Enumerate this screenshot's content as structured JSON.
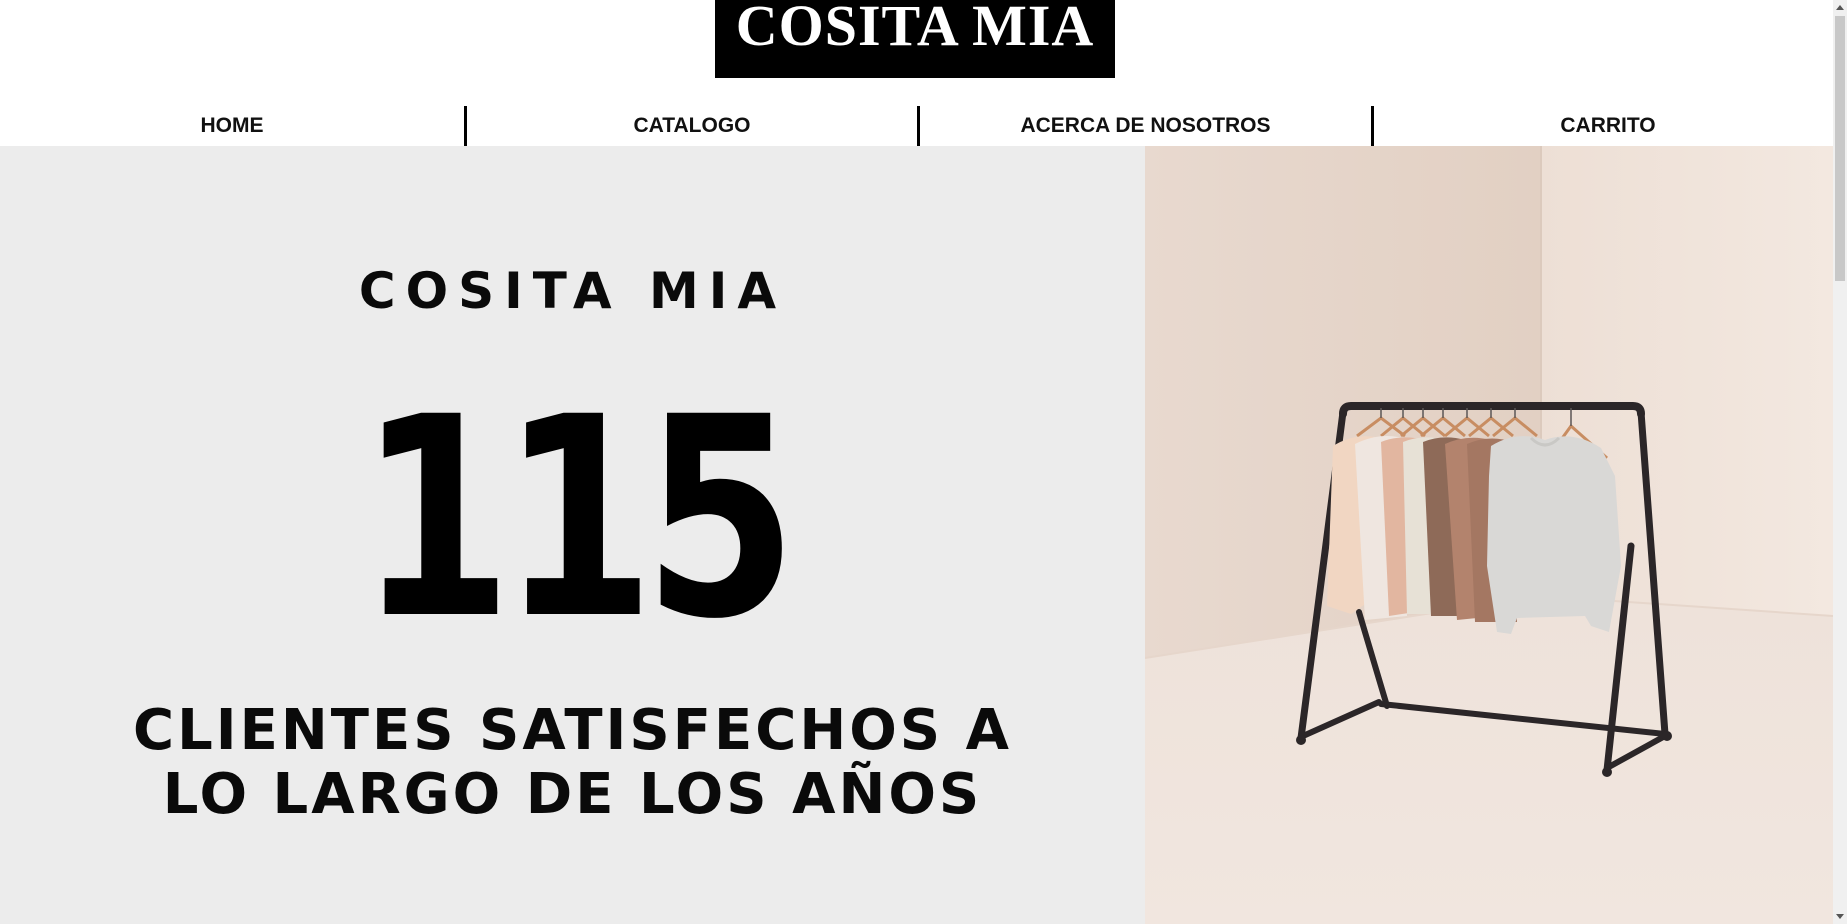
{
  "header": {
    "logo_text": "COSITA MIA"
  },
  "nav": {
    "items": [
      {
        "label": "HOME"
      },
      {
        "label": "CATALOGO"
      },
      {
        "label": "ACERCA DE NOSOTROS"
      },
      {
        "label": "CARRITO"
      }
    ]
  },
  "hero": {
    "brand": "COSITA MIA",
    "stat_number": "115",
    "caption_line1": "CLIENTES SATISFECHOS A",
    "caption_line2": "LO LARGO DE LOS AÑOS",
    "image_subject": "clothing-rack-photo",
    "panel_color": "#ececec"
  },
  "colors": {
    "logo_bg": "#000000",
    "logo_text": "#ffffff",
    "nav_text": "#111111",
    "photo_wall": "#efe2d8"
  }
}
